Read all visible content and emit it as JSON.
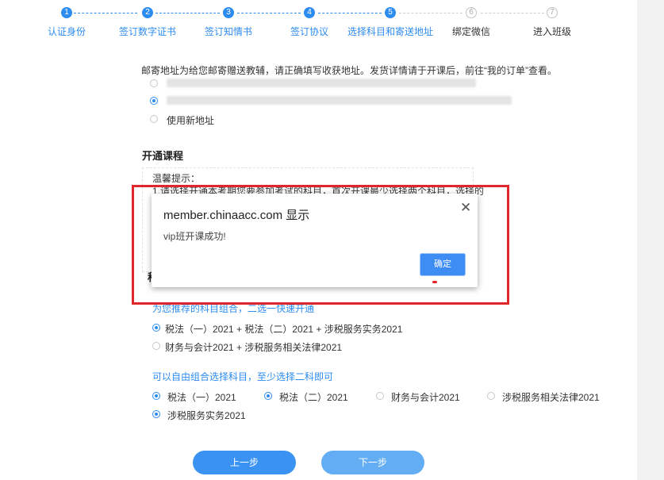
{
  "steps": [
    {
      "num": "1",
      "label": "认证身份",
      "done": true
    },
    {
      "num": "2",
      "label": "签订数字证书",
      "done": true
    },
    {
      "num": "3",
      "label": "签订知情书",
      "done": true
    },
    {
      "num": "4",
      "label": "签订协议",
      "done": true
    },
    {
      "num": "5",
      "label": "选择科目和寄送地址",
      "done": true
    },
    {
      "num": "6",
      "label": "绑定微信",
      "done": false
    },
    {
      "num": "7",
      "label": "进入班级",
      "done": false
    }
  ],
  "address": {
    "notice": "邮寄地址为给您邮寄赠送教辅，请正确填写收获地址。发货详情请于开课后，前往“我的订单”查看。",
    "new_address_label": "使用新地址"
  },
  "course": {
    "title": "开通课程",
    "tip_title": "温馨提示：",
    "tip_line1": "1.请选择开通本考期您要参加考试的科目，首次开课最少选择两个科目，选择的"
  },
  "subjects": {
    "title_partial": "科",
    "recommend_label": "为您推荐的科目组合，二选一快速开通",
    "combos": [
      "税法（一）2021 + 税法（二）2021 + 涉税服务实务2021",
      "财务与会计2021 + 涉税服务相关法律2021"
    ],
    "free_label": "可以自由组合选择科目，至少选择二科即可",
    "items": [
      "税法（一）2021",
      "税法（二）2021",
      "财务与会计2021",
      "涉税服务相关法律2021",
      "涉税服务实务2021"
    ]
  },
  "buttons": {
    "prev": "上一步",
    "next": "下一步"
  },
  "dialog": {
    "title": "member.chinaacc.com 显示",
    "message": "vip班开课成功!",
    "ok": "确定",
    "close": "✕"
  }
}
